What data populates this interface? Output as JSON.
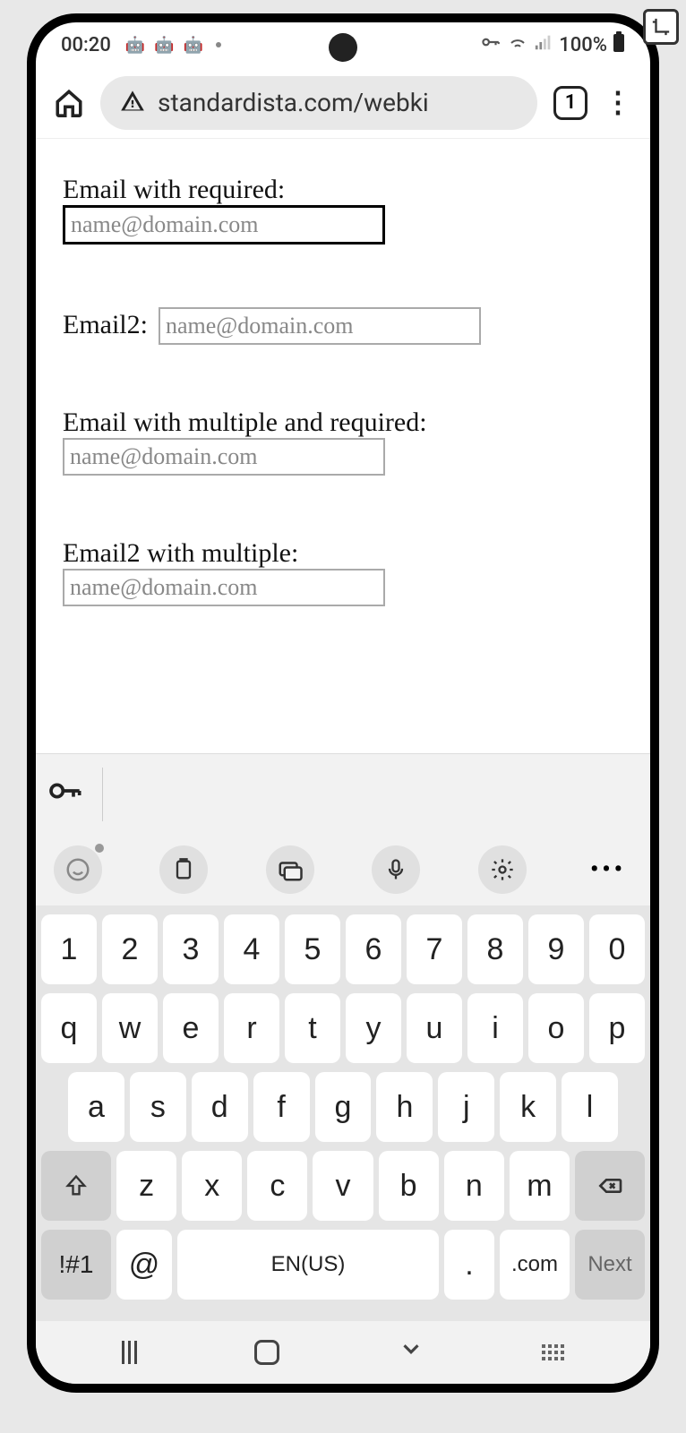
{
  "status": {
    "time": "00:20",
    "battery": "100%"
  },
  "browser": {
    "url": "standardista.com/webki",
    "tab_count": "1"
  },
  "form": {
    "field1": {
      "label": "Email with required:",
      "placeholder": "name@domain.com"
    },
    "field2": {
      "label": "Email2:",
      "placeholder": "name@domain.com"
    },
    "field3": {
      "label": "Email with multiple and required:",
      "placeholder": "name@domain.com"
    },
    "field4": {
      "label": "Email2 with multiple:",
      "placeholder": "name@domain.com"
    }
  },
  "keyboard": {
    "row_num": [
      "1",
      "2",
      "3",
      "4",
      "5",
      "6",
      "7",
      "8",
      "9",
      "0"
    ],
    "row_top": [
      "q",
      "w",
      "e",
      "r",
      "t",
      "y",
      "u",
      "i",
      "o",
      "p"
    ],
    "row_mid": [
      "a",
      "s",
      "d",
      "f",
      "g",
      "h",
      "j",
      "k",
      "l"
    ],
    "row_bot": [
      "z",
      "x",
      "c",
      "v",
      "b",
      "n",
      "m"
    ],
    "sym": "!#1",
    "at": "@",
    "space": "EN(US)",
    "period": ".",
    "com": ".com",
    "next": "Next"
  }
}
